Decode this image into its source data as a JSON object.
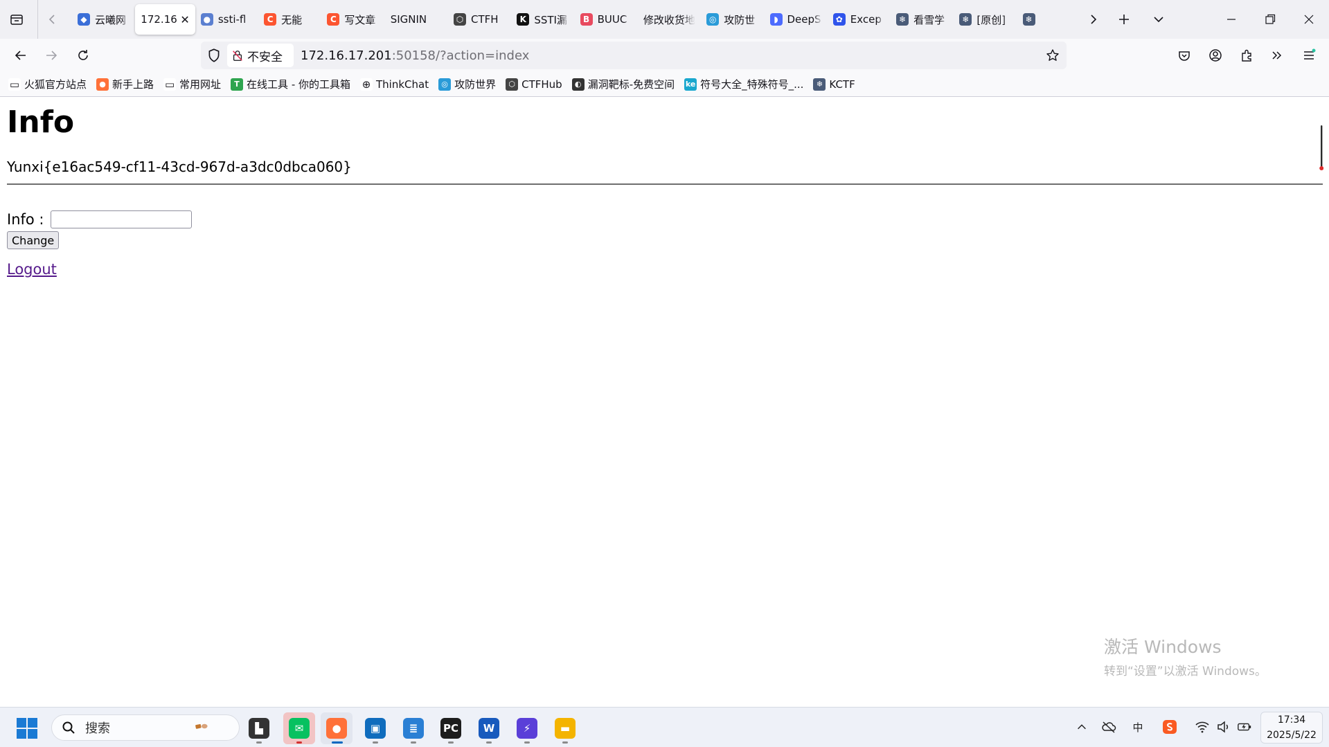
{
  "browser": {
    "tabs": [
      {
        "title": "云曦网",
        "icon": "site-icon",
        "color": "#3b6fd8",
        "glyph": "◆"
      },
      {
        "title": "172.16.",
        "icon": "page-icon",
        "color": "#ffffff",
        "glyph": ""
      },
      {
        "title": "ssti-fl",
        "icon": "globe-icon",
        "color": "#5b7fd0",
        "glyph": "●"
      },
      {
        "title": "无能",
        "icon": "csdn-icon",
        "color": "#fc5531",
        "glyph": "C"
      },
      {
        "title": "写文章",
        "icon": "csdn-icon",
        "color": "#fc5531",
        "glyph": "C"
      },
      {
        "title": "SIGNIN",
        "icon": "blank-icon",
        "color": "#f0f0f4",
        "glyph": ""
      },
      {
        "title": "CTFH",
        "icon": "cube-icon",
        "color": "#444444",
        "glyph": "⬡"
      },
      {
        "title": "SSTI漏",
        "icon": "k-icon",
        "color": "#111111",
        "glyph": "K"
      },
      {
        "title": "BUUC",
        "icon": "buu-icon",
        "color": "#e84a5f",
        "glyph": "B"
      },
      {
        "title": "修改收货地",
        "icon": "blank-icon",
        "color": "#f0f0f4",
        "glyph": ""
      },
      {
        "title": "攻防世",
        "icon": "wave-icon",
        "color": "#2a9bd8",
        "glyph": "◎"
      },
      {
        "title": "DeepS",
        "icon": "whale-icon",
        "color": "#4d6bfe",
        "glyph": "◗"
      },
      {
        "title": "Excep",
        "icon": "paw-icon",
        "color": "#2f54eb",
        "glyph": "✿"
      },
      {
        "title": "看雪学",
        "icon": "snowflake-icon",
        "color": "#4a5b78",
        "glyph": "❄"
      },
      {
        "title": "[原创]",
        "icon": "snowflake-icon",
        "color": "#4a5b78",
        "glyph": "❄"
      },
      {
        "title": "",
        "icon": "snowflake-icon",
        "color": "#4a5b78",
        "glyph": "❄"
      }
    ],
    "active_tab_index": 1,
    "security_label": "不安全",
    "url_host": "172.16.17.201",
    "url_rest": ":50158/?action=index"
  },
  "bookmarks": [
    {
      "label": "火狐官方站点",
      "icon": "folder-icon",
      "color": "#ffffff",
      "glyph": "▭"
    },
    {
      "label": "新手上路",
      "icon": "firefox-icon",
      "color": "#ff7139",
      "glyph": "●"
    },
    {
      "label": "常用网址",
      "icon": "folder-icon",
      "color": "#ffffff",
      "glyph": "▭"
    },
    {
      "label": "在线工具 - 你的工具箱",
      "icon": "tool-icon",
      "color": "#2ea44f",
      "glyph": "T"
    },
    {
      "label": "ThinkChat",
      "icon": "globe-icon",
      "color": "#ffffff",
      "glyph": "⊕"
    },
    {
      "label": "攻防世界",
      "icon": "wave-icon",
      "color": "#2a9bd8",
      "glyph": "◎"
    },
    {
      "label": "CTFHub",
      "icon": "cube-icon",
      "color": "#444444",
      "glyph": "⬡"
    },
    {
      "label": "漏洞靶标-免费空间",
      "icon": "spiral-icon",
      "color": "#333333",
      "glyph": "◐"
    },
    {
      "label": "符号大全_特殊符号_...",
      "icon": "ke-icon",
      "color": "#19a7ce",
      "glyph": "ke"
    },
    {
      "label": "KCTF",
      "icon": "snowflake-icon",
      "color": "#4a5b78",
      "glyph": "❄"
    }
  ],
  "page": {
    "heading": "Info",
    "flag": "Yunxi{e16ac549-cf11-43cd-967d-a3dc0dbca060}",
    "form": {
      "label": "Info :",
      "value": "",
      "button": "Change"
    },
    "logout": "Logout"
  },
  "watermark": {
    "line1": "激活 Windows",
    "line2": "转到“设置”以激活 Windows。"
  },
  "taskbar": {
    "search_placeholder": "搜索",
    "apps": [
      {
        "name": "file-viewer-app",
        "color": "#333333",
        "glyph": "▙",
        "dot": true
      },
      {
        "name": "wechat-app",
        "color": "#07c160",
        "glyph": "✉",
        "dot": true,
        "highlight": true
      },
      {
        "name": "firefox-app",
        "color": "#ff7139",
        "glyph": "●",
        "dot": true,
        "active": true
      },
      {
        "name": "remote-desktop-app",
        "color": "#0f6cbd",
        "glyph": "▣",
        "dot": true
      },
      {
        "name": "notepad-app",
        "color": "#2a7fd4",
        "glyph": "≣",
        "dot": true
      },
      {
        "name": "pycharm-app",
        "color": "#1d1d1d",
        "glyph": "PC",
        "dot": true
      },
      {
        "name": "word-app",
        "color": "#185abd",
        "glyph": "W",
        "dot": true
      },
      {
        "name": "burp-app",
        "color": "#5a3fd8",
        "glyph": "⚡",
        "dot": true
      },
      {
        "name": "file-explorer-app",
        "color": "#f4b400",
        "glyph": "▬",
        "dot": true
      }
    ],
    "tray": {
      "ime": "中",
      "time": "17:34",
      "date": "2025/5/22"
    }
  }
}
